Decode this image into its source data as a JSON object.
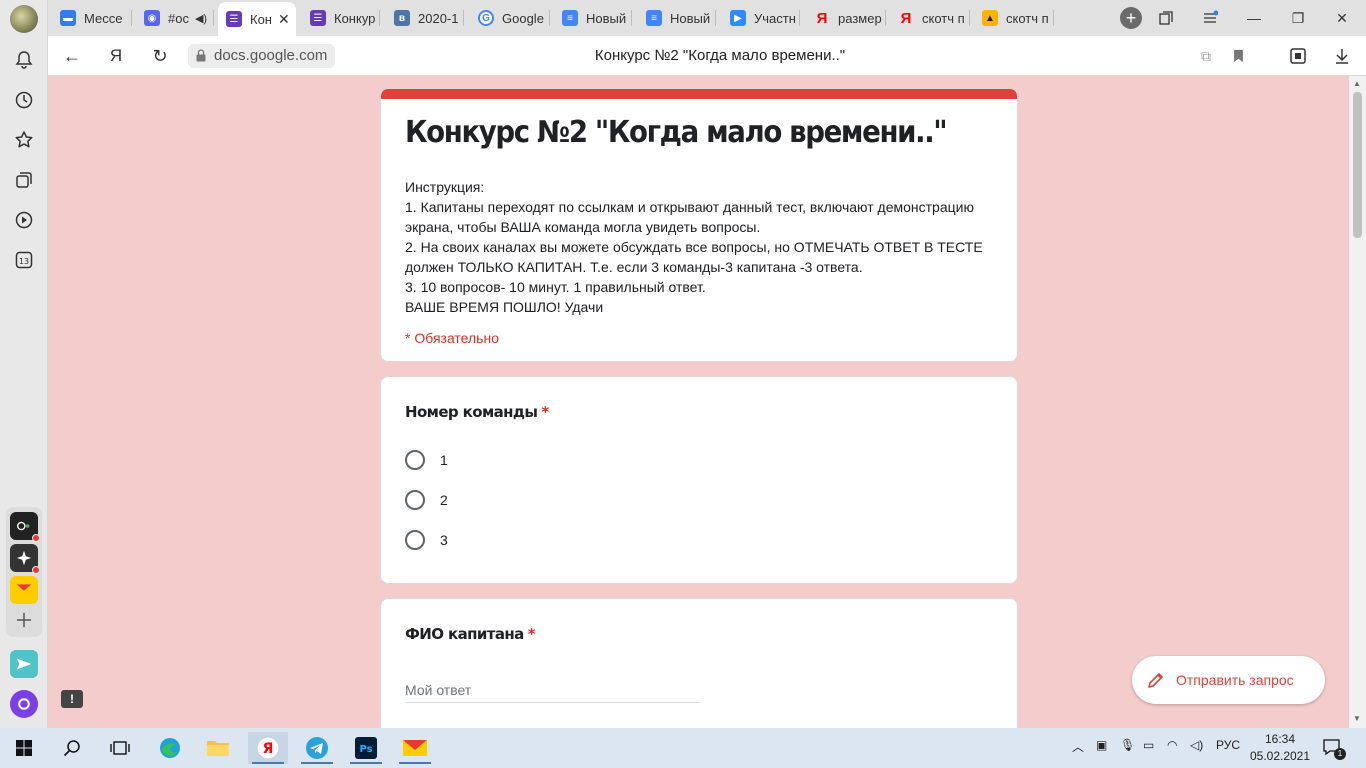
{
  "browser": {
    "tabs": [
      {
        "label": "Мессе",
        "icon": "messenger-icon",
        "color": "#2f80ed"
      },
      {
        "label": "#ос",
        "icon": "discord-icon",
        "color": "#5865f2"
      },
      {
        "label": "Кон",
        "icon": "google-forms-icon",
        "color": "#673ab7",
        "active": true
      },
      {
        "label": "Конкур",
        "icon": "google-forms-icon",
        "color": "#673ab7"
      },
      {
        "label": "2020-1",
        "icon": "vk-icon",
        "color": "#4a76a8"
      },
      {
        "label": "Google",
        "icon": "google-icon",
        "color": "#4285f4"
      },
      {
        "label": "Новый",
        "icon": "google-docs-icon",
        "color": "#4285f4"
      },
      {
        "label": "Новый",
        "icon": "google-docs-icon",
        "color": "#4285f4"
      },
      {
        "label": "Участн",
        "icon": "zoom-icon",
        "color": "#2d8cff"
      },
      {
        "label": "размер",
        "icon": "yandex-icon",
        "color": "#ff0000"
      },
      {
        "label": "скотч п",
        "icon": "yandex-icon",
        "color": "#ff0000"
      },
      {
        "label": "скотч п",
        "icon": "yandex-images-icon",
        "color": "#ffb300"
      }
    ],
    "address": {
      "domain": "docs.google.com",
      "page_title": "Конкурс №2 \"Когда мало времени..\""
    },
    "rail_counter": "13"
  },
  "form": {
    "title": "Конкурс №2 \"Когда мало времени..\"",
    "description": "Инструкция:\n1. Капитаны переходят по ссылкам и открывают данный тест, включают демонстрацию экрана, чтобы ВАША команда могла увидеть вопросы.\n2. На своих каналах вы можете обсуждать все вопросы, но ОТМЕЧАТЬ ОТВЕТ В ТЕСТЕ должен ТОЛЬКО КАПИТАН. Т.е. если 3 команды-3 капитана -3 ответа.\n3. 10 вопросов- 10 минут. 1 правильный ответ.\nВАШЕ ВРЕМЯ ПОШЛО! Удачи",
    "required_note": "* Обязательно",
    "accent_color": "#db4437",
    "questions": [
      {
        "title": "Номер команды",
        "required_mark": "*",
        "options": [
          "1",
          "2",
          "3"
        ]
      },
      {
        "title": "ФИО капитана",
        "required_mark": "*",
        "placeholder": "Мой ответ"
      }
    ]
  },
  "floating": {
    "send_request_label": "Отправить запрос"
  },
  "taskbar": {
    "language": "РУС",
    "time": "16:34",
    "date": "05.02.2021",
    "notification_count": "1"
  }
}
